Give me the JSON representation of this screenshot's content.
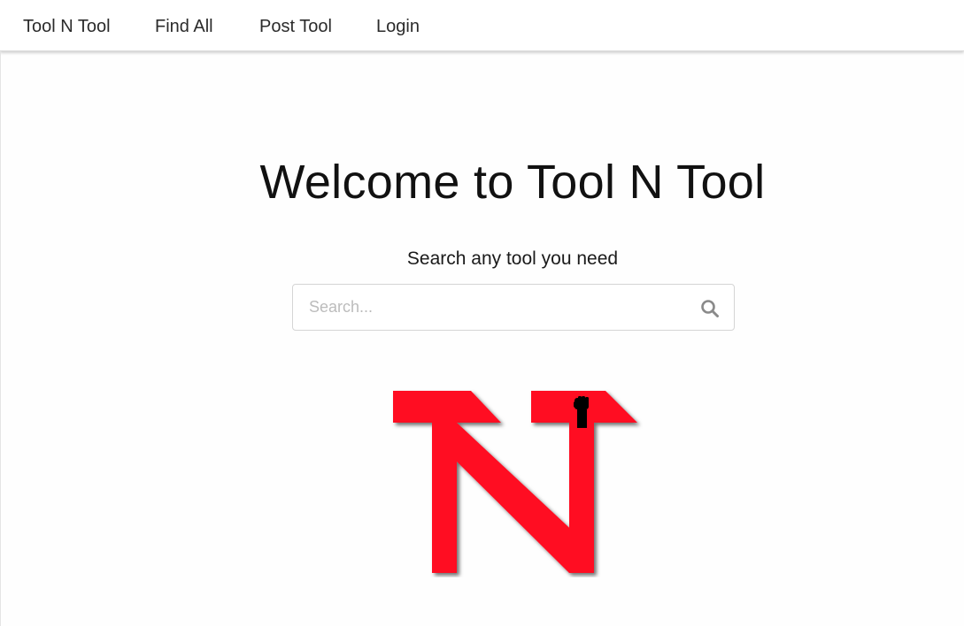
{
  "nav": {
    "brand": "Tool N Tool",
    "items": [
      {
        "label": "Find All"
      },
      {
        "label": "Post Tool"
      },
      {
        "label": "Login"
      }
    ]
  },
  "hero": {
    "title": "Welcome to Tool N Tool",
    "subtitle": "Search any tool you need"
  },
  "search": {
    "placeholder": "Search...",
    "value": "",
    "icon": "search-icon"
  },
  "colors": {
    "logo_red": "#ff0a23",
    "text_dark": "#111111",
    "placeholder": "#bcbcbc"
  }
}
